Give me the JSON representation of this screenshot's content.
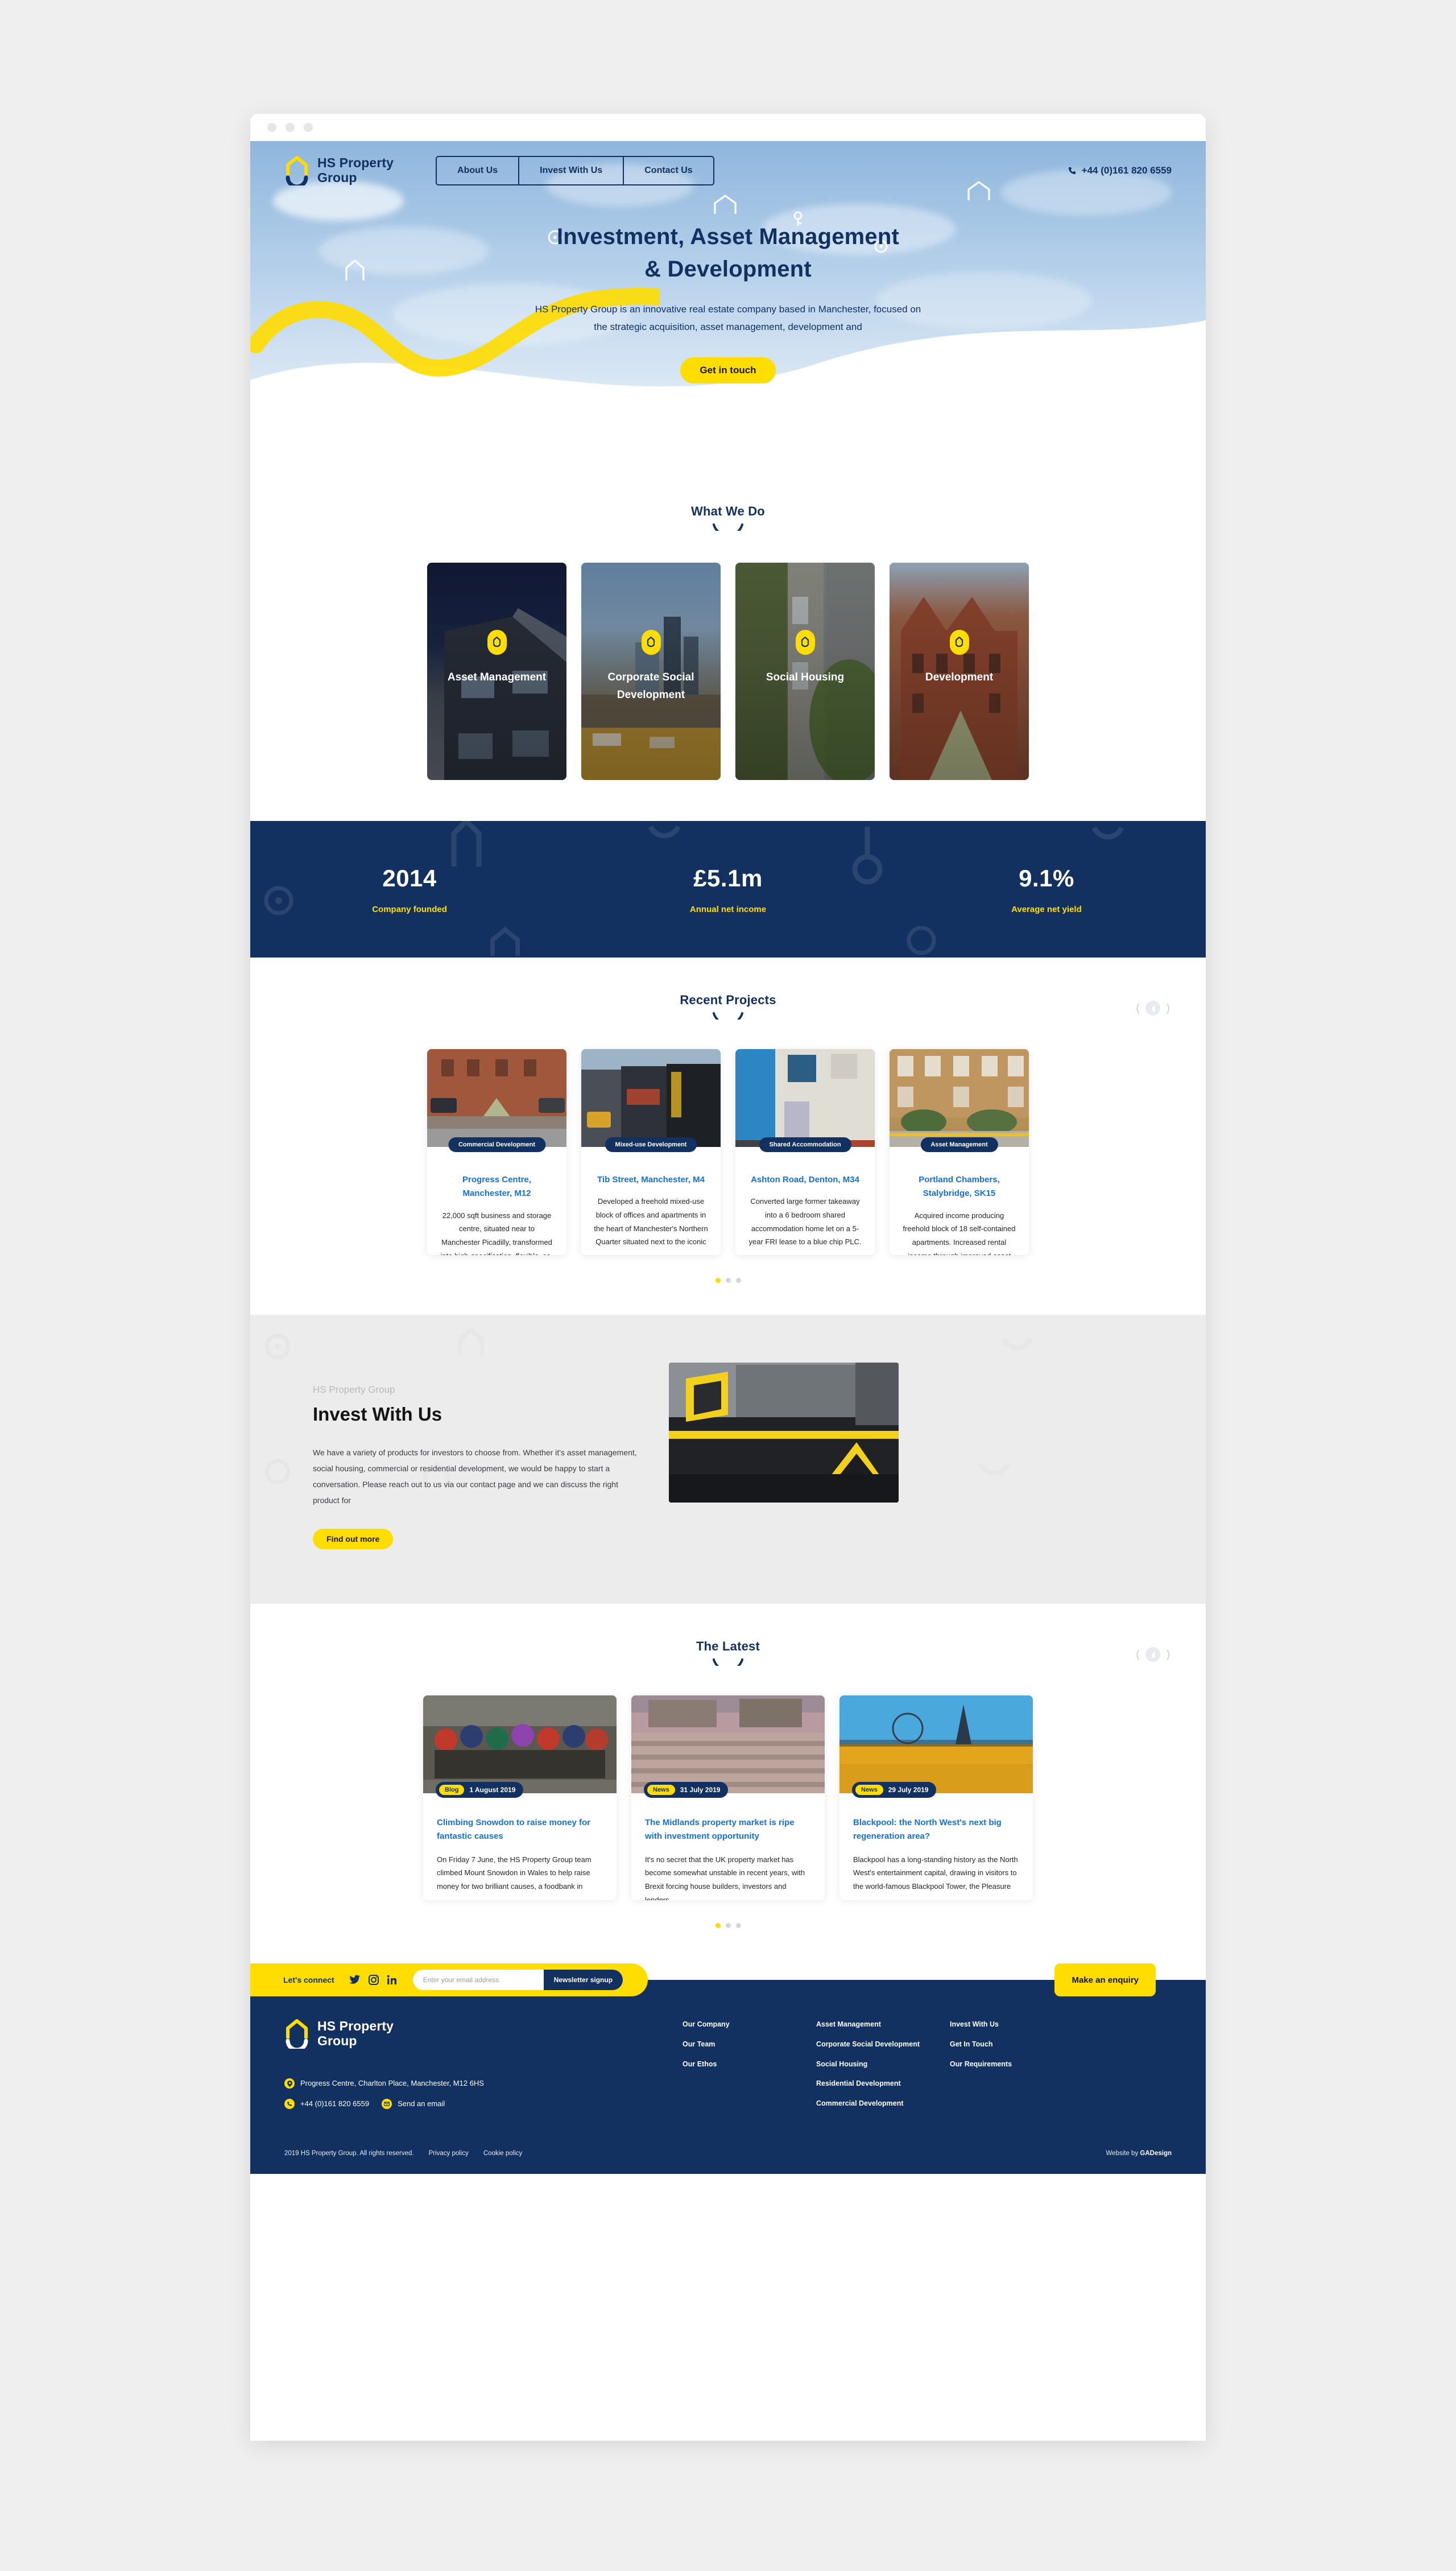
{
  "brand": {
    "name_line1": "HS Property",
    "name_line2": "Group",
    "accent_yellow": "#FFDD00",
    "navy": "#123160",
    "link_blue": "#1470dd"
  },
  "header": {
    "nav": [
      {
        "label": "About Us"
      },
      {
        "label": "Invest With Us"
      },
      {
        "label": "Contact Us"
      }
    ],
    "phone": "+44 (0)161 820 6559",
    "phone_icon": "phone-icon"
  },
  "hero": {
    "title_line1": "Investment, Asset Management",
    "title_line2": "& Development",
    "subtitle": "HS Property Group is an innovative real estate company based in Manchester, focused on the strategic acquisition, asset management, development and",
    "cta": "Get in touch"
  },
  "what_we_do": {
    "heading": "What We Do",
    "cards": [
      {
        "title": "Asset Management",
        "icon": "house-badge-icon"
      },
      {
        "title": "Corporate Social Development",
        "icon": "house-badge-icon"
      },
      {
        "title": "Social Housing",
        "icon": "house-badge-icon"
      },
      {
        "title": "Development",
        "icon": "house-badge-icon"
      }
    ]
  },
  "stats": [
    {
      "value": "2014",
      "label": "Company founded"
    },
    {
      "value": "£5.1m",
      "label": "Annual net income"
    },
    {
      "value": "9.1%",
      "label": "Average net yield"
    }
  ],
  "recent_projects": {
    "heading": "Recent Projects",
    "prev_icon": "chevron-left-icon",
    "next_icon": "chevron-right-icon",
    "cards": [
      {
        "tag": "Commercial Development",
        "title": "Progress Centre, Manchester, M12",
        "body": "22,000 sqft business and storage centre, situated near to Manchester Picadilly, transformed into high-specification, flexible, co-"
      },
      {
        "tag": "Mixed-use Development",
        "title": "Tib Street, Manchester, M4",
        "body": "Developed a freehold mixed-use block of offices and apartments in the heart of Manchester's Northern Quarter situated next to the iconic"
      },
      {
        "tag": "Shared Accommodation",
        "title": "Ashton Road, Denton, M34",
        "body": "Converted large former takeaway into a 6 bedroom shared accommodation home let on a 5-year FRI lease to a blue chip PLC."
      },
      {
        "tag": "Asset Management",
        "title": "Portland Chambers, Stalybridge, SK15",
        "body": "Acquired income producing freehold block of 18 self-contained apartments. Increased rental income through improved asset"
      }
    ],
    "dots": [
      true,
      false,
      false
    ]
  },
  "invest": {
    "eyebrow": "HS Property Group",
    "heading": "Invest With Us",
    "body": "We have a variety of products for investors to choose from. Whether it's asset management, social housing, commercial or residential development, we would be happy to start a conversation. Please reach out to us via our contact page and we can discuss the right product for",
    "cta": "Find out more"
  },
  "latest": {
    "heading": "The Latest",
    "prev_icon": "chevron-left-icon",
    "next_icon": "chevron-right-icon",
    "cards": [
      {
        "kind": "Blog",
        "date": "1 August 2019",
        "title": "Climbing Snowdon to raise money for fantastic causes",
        "body": "On Friday 7 June, the HS Property Group team climbed Mount Snowdon in Wales to help raise money for two brilliant causes, a foodbank in"
      },
      {
        "kind": "News",
        "date": "31 July 2019",
        "title": "The Midlands property market is ripe with investment opportunity",
        "body": "It's no secret that the UK property market has become somewhat unstable in recent years, with Brexit forcing house builders, investors and lenders"
      },
      {
        "kind": "News",
        "date": "29 July 2019",
        "title": "Blackpool: the North West's next big regeneration area?",
        "body": "Blackpool has a long-standing history as the North West's entertainment capital, drawing in visitors to the world-famous Blackpool Tower, the Pleasure"
      }
    ],
    "dots": [
      true,
      false,
      false
    ]
  },
  "connect": {
    "label": "Let's connect",
    "social": [
      {
        "name": "twitter-icon"
      },
      {
        "name": "instagram-icon"
      },
      {
        "name": "linkedin-icon"
      }
    ],
    "email_placeholder": "Enter your email address",
    "email_value": "",
    "signup_label": "Newsletter signup",
    "enquiry_label": "Make an enquiry"
  },
  "footer": {
    "address": "Progress Centre, Charlton Place, Manchester, M12 6HS",
    "phone": "+44 (0)161 820 6559",
    "email_label": "Send an email",
    "pin_icon": "location-pin-icon",
    "phone_icon": "phone-icon",
    "mail_icon": "envelope-icon",
    "columns": [
      {
        "links": [
          "Our Company",
          "Our Team",
          "Our Ethos"
        ]
      },
      {
        "links": [
          "Asset Management",
          "Corporate Social Development",
          "Social Housing",
          "Residential Development",
          "Commercial Development"
        ]
      },
      {
        "links": [
          "Invest With Us",
          "Get In Touch",
          "Our Requirements"
        ]
      }
    ],
    "copyright": "2019 HS Property Group. All rights reserved.",
    "legal": [
      "Privacy policy",
      "Cookie policy"
    ],
    "credit_prefix": "Website by ",
    "credit_name": "GADesign"
  }
}
